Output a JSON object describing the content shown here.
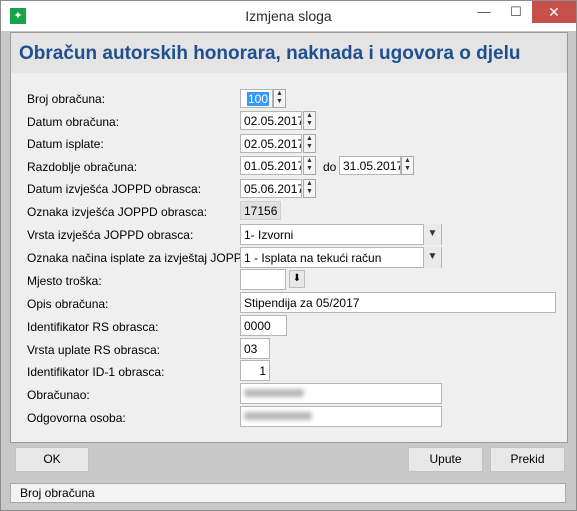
{
  "window": {
    "title": "Izmjena sloga",
    "min_glyph": "—",
    "max_glyph": "☐",
    "close_glyph": "✕"
  },
  "form": {
    "heading": "Obračun autorskih honorara, naknada i ugovora o djelu",
    "labels": {
      "broj_obracuna": "Broj obračuna:",
      "datum_obracuna": "Datum obračuna:",
      "datum_isplate": "Datum isplate:",
      "razdoblje_obracuna": "Razdoblje obračuna:",
      "do": "do",
      "datum_izvjesca": "Datum izvješća JOPPD obrasca:",
      "oznaka_izvjesca": "Oznaka izvješća JOPPD obrasca:",
      "vrsta_izvjesca": "Vrsta izvješća JOPPD obrasca:",
      "oznaka_nacina": "Oznaka načina isplate za izvještaj JOPPD:",
      "mjesto_troska": "Mjesto troška:",
      "opis_obracuna": "Opis obračuna:",
      "identifikator_rs": "Identifikator RS obrasca:",
      "vrsta_uplate_rs": "Vrsta uplate RS obrasca:",
      "identifikator_id1": "Identifikator ID-1 obrasca:",
      "obracunao": "Obračunao:",
      "odgovorna_osoba": "Odgovorna osoba:"
    },
    "values": {
      "broj_obracuna": "100",
      "datum_obracuna": "02.05.2017",
      "datum_isplate": "02.05.2017",
      "razdoblje_od": "01.05.2017",
      "razdoblje_do": "31.05.2017",
      "datum_izvjesca": "05.06.2017",
      "oznaka_izvjesca": "17156",
      "vrsta_izvjesca": "1- Izvorni",
      "oznaka_nacina": "1 - Isplata na tekući račun",
      "mjesto_troska": "",
      "opis_obracuna": "Stipendija za 05/2017",
      "identifikator_rs": "0000",
      "vrsta_uplate_rs": "03",
      "identifikator_id1": "1",
      "obracunao": "",
      "odgovorna_osoba": ""
    }
  },
  "buttons": {
    "ok": "OK",
    "upute": "Upute",
    "prekid": "Prekid"
  },
  "status": {
    "text": "Broj obračuna"
  },
  "colors": {
    "heading": "#1f4f8f",
    "selection": "#3399ff",
    "close": "#c7504b"
  }
}
